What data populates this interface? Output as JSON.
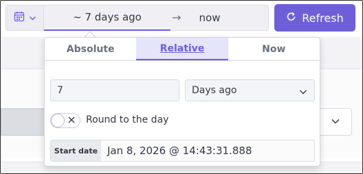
{
  "datepicker": {
    "calendar_icon": "calendar-icon",
    "start_label": "~ 7 days ago",
    "arrow": "→",
    "end_label": "now"
  },
  "refresh": {
    "label": "Refresh",
    "icon": "refresh-icon",
    "color": "#6e5fd9"
  },
  "popover": {
    "tabs": [
      {
        "label": "Absolute",
        "active": false
      },
      {
        "label": "Relative",
        "active": true
      },
      {
        "label": "Now",
        "active": false
      }
    ],
    "amount_value": "7",
    "unit_value": "Days ago",
    "round_toggle": {
      "label": "Round to the day",
      "checked": false
    },
    "start_date": {
      "label": "Start date",
      "value": "Jan 8, 2026 @ 14:43:31.888"
    }
  },
  "colors": {
    "accent": "#6b5fdc",
    "active_tab_bg": "#e6e4fb"
  }
}
